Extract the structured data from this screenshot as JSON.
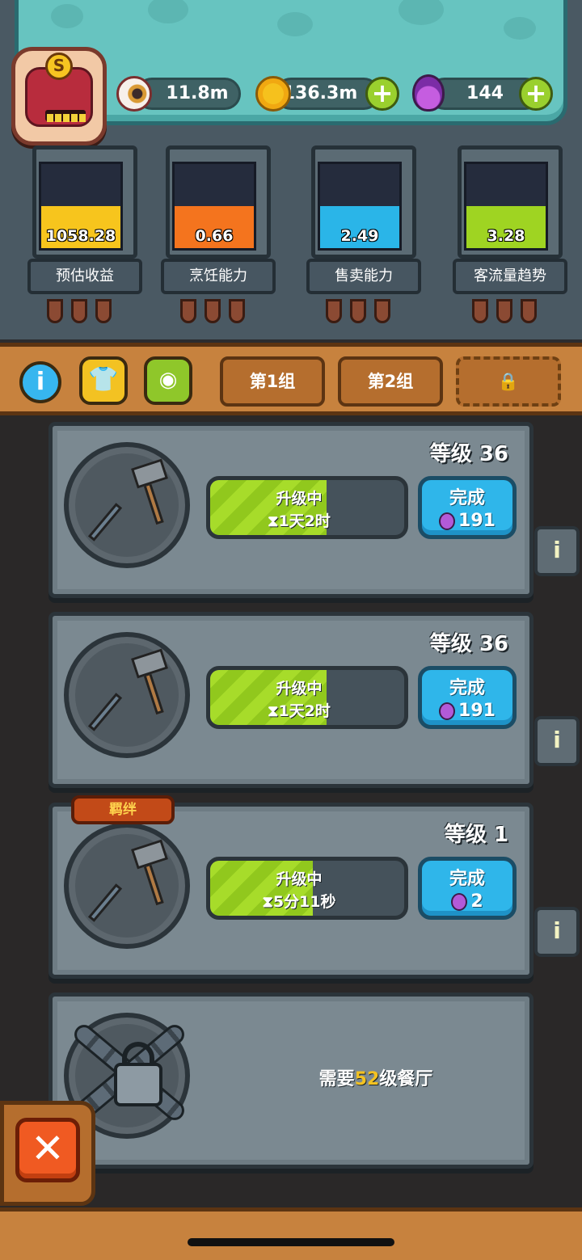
{
  "resources": {
    "eyes": "11.8m",
    "coins": "136.3m",
    "potions": "144"
  },
  "stats": [
    {
      "value": "1058.28",
      "label": "预估收益",
      "color": "#f7c51d",
      "fill": 0.5
    },
    {
      "value": "0.66",
      "label": "烹饪能力",
      "color": "#f4741e",
      "fill": 0.5
    },
    {
      "value": "2.49",
      "label": "售卖能力",
      "color": "#2ab5e8",
      "fill": 0.5
    },
    {
      "value": "3.28",
      "label": "客流量趋势",
      "color": "#9fd422",
      "fill": 0.5
    }
  ],
  "toolbar": {
    "tabs": [
      "第1组",
      "第2组"
    ]
  },
  "slots": [
    {
      "level": "等级 36",
      "status": "升级中",
      "time": "1天2时",
      "finish": "完成",
      "cost": "191",
      "progress": 0.6
    },
    {
      "level": "等级 36",
      "status": "升级中",
      "time": "1天2时",
      "finish": "完成",
      "cost": "191",
      "progress": 0.6
    },
    {
      "level": "等级 1",
      "status": "升级中",
      "time": "5分11秒",
      "finish": "完成",
      "cost": "2",
      "progress": 0.53,
      "badge": "羁绊"
    }
  ],
  "locked": {
    "prefix": "需要",
    "level": "52",
    "suffix": "级餐厅"
  },
  "colors": {
    "teal": "#67c4c0",
    "wood": "#c7823e",
    "progress": "#a7dc2a",
    "finish": "#2fb6ea",
    "close": "#f05a22"
  }
}
